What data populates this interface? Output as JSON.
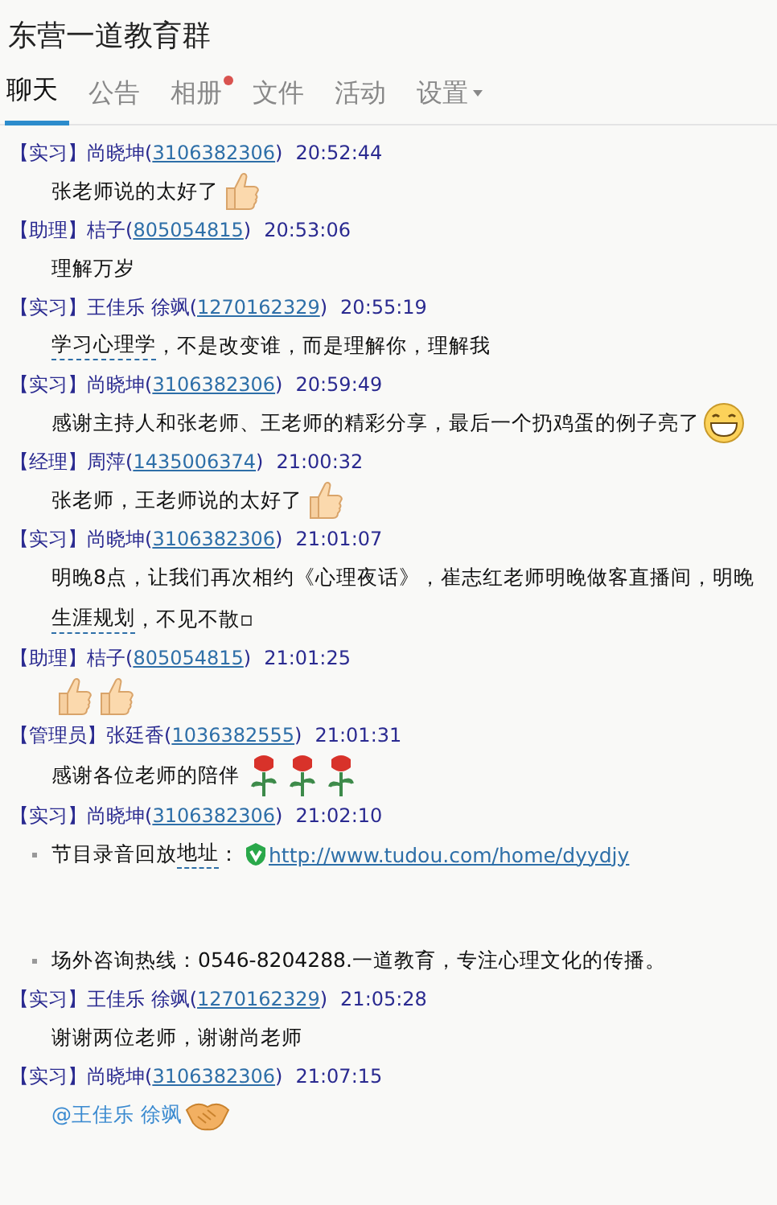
{
  "window": {
    "title": "东营一道教育群"
  },
  "tabs": [
    {
      "label": "聊天",
      "selected": true,
      "dot": false,
      "dropdown": false
    },
    {
      "label": "公告",
      "selected": false,
      "dot": false,
      "dropdown": false
    },
    {
      "label": "相册",
      "selected": false,
      "dot": true,
      "dropdown": false
    },
    {
      "label": "文件",
      "selected": false,
      "dot": false,
      "dropdown": false
    },
    {
      "label": "活动",
      "selected": false,
      "dot": false,
      "dropdown": false
    },
    {
      "label": "设置",
      "selected": false,
      "dot": false,
      "dropdown": true
    }
  ],
  "messages": [
    {
      "role": "【实习】",
      "name": "尚晓坤(",
      "qq": "3106382306",
      "close": ")",
      "time": "20:52:44",
      "lines": [
        {
          "bullet": false,
          "parts": [
            {
              "kind": "text",
              "text": "张老师说的太好了"
            },
            {
              "kind": "thumb"
            }
          ]
        }
      ]
    },
    {
      "role": "【助理】",
      "name": "桔子(",
      "qq": "805054815",
      "close": ")",
      "time": "20:53:06",
      "lines": [
        {
          "bullet": false,
          "parts": [
            {
              "kind": "text",
              "text": "理解万岁"
            }
          ]
        }
      ]
    },
    {
      "role": "【实习】",
      "name": "王佳乐 徐飒(",
      "qq": "1270162329",
      "close": ")",
      "time": "20:55:19",
      "lines": [
        {
          "bullet": false,
          "parts": [
            {
              "kind": "keyword",
              "text": "学习心理学"
            },
            {
              "kind": "text",
              "text": "，不是改变谁，而是理解你，理解我"
            }
          ]
        }
      ]
    },
    {
      "role": "【实习】",
      "name": "尚晓坤(",
      "qq": "3106382306",
      "close": ")",
      "time": "20:59:49",
      "lines": [
        {
          "bullet": false,
          "parts": [
            {
              "kind": "text",
              "text": "感谢主持人和张老师、王老师的精彩分享，最后一个扔鸡蛋的例子亮了"
            },
            {
              "kind": "grin"
            }
          ]
        }
      ]
    },
    {
      "role": "【经理】",
      "name": "周萍(",
      "qq": "1435006374",
      "close": ")",
      "time": "21:00:32",
      "lines": [
        {
          "bullet": false,
          "parts": [
            {
              "kind": "text",
              "text": "张老师，王老师说的太好了"
            },
            {
              "kind": "thumb"
            }
          ]
        }
      ]
    },
    {
      "role": "【实习】",
      "name": "尚晓坤(",
      "qq": "3106382306",
      "close": ")",
      "time": "21:01:07",
      "lines": [
        {
          "bullet": false,
          "parts": [
            {
              "kind": "text",
              "text": "明晚8点，让我们再次相约《心理夜话》，崔志红老师明晚做客直播间，明晚"
            }
          ]
        },
        {
          "bullet": false,
          "parts": [
            {
              "kind": "keyword",
              "text": "生涯规划"
            },
            {
              "kind": "text",
              "text": "，不见不散▫"
            }
          ]
        }
      ]
    },
    {
      "role": "【助理】",
      "name": "桔子(",
      "qq": "805054815",
      "close": ")",
      "time": "21:01:25",
      "lines": [
        {
          "bullet": false,
          "parts": [
            {
              "kind": "thumb"
            },
            {
              "kind": "thumb"
            }
          ]
        }
      ]
    },
    {
      "role": "【管理员】",
      "name": "张廷香(",
      "qq": "1036382555",
      "close": ")",
      "time": "21:01:31",
      "lines": [
        {
          "bullet": false,
          "parts": [
            {
              "kind": "text",
              "text": "感谢各位老师的陪伴"
            },
            {
              "kind": "rose"
            },
            {
              "kind": "rose"
            },
            {
              "kind": "rose"
            }
          ]
        }
      ]
    },
    {
      "role": "【实习】",
      "name": "尚晓坤(",
      "qq": "3106382306",
      "close": ")",
      "time": "21:02:10",
      "lines": [
        {
          "bullet": true,
          "parts": [
            {
              "kind": "text",
              "text": "节目录音回放"
            },
            {
              "kind": "keyword",
              "text": "地址"
            },
            {
              "kind": "text",
              "text": "："
            },
            {
              "kind": "badge"
            },
            {
              "kind": "link",
              "text": "http://www.tudou.com/home/dyydjy"
            }
          ]
        },
        {
          "bullet": true,
          "gap": true,
          "parts": [
            {
              "kind": "text",
              "text": "场外咨询热线：0546-8204288.一道教育，专注心理文化的传播。"
            }
          ]
        }
      ]
    },
    {
      "role": "【实习】",
      "name": "王佳乐 徐飒(",
      "qq": "1270162329",
      "close": ")",
      "time": "21:05:28",
      "lines": [
        {
          "bullet": false,
          "parts": [
            {
              "kind": "text",
              "text": "谢谢两位老师，谢谢尚老师"
            }
          ]
        }
      ]
    },
    {
      "role": "【实习】",
      "name": "尚晓坤(",
      "qq": "3106382306",
      "close": ")",
      "time": "21:07:15",
      "lines": [
        {
          "bullet": false,
          "parts": [
            {
              "kind": "mention",
              "text": "@王佳乐 徐飒"
            },
            {
              "kind": "handshake"
            }
          ]
        }
      ]
    }
  ]
}
